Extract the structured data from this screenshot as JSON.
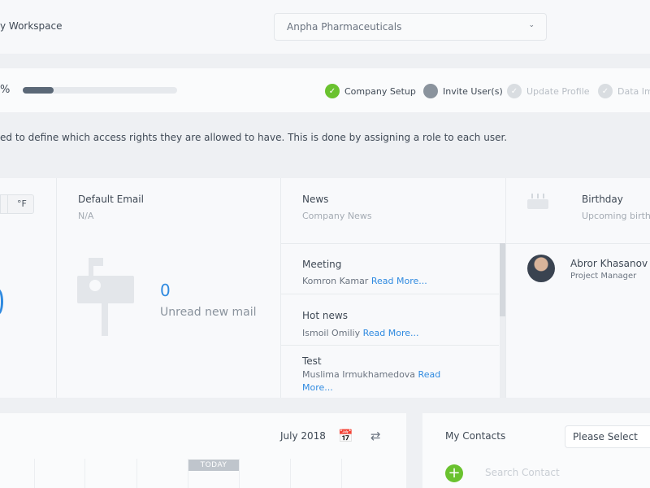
{
  "header": {
    "workspace_label": "y Workspace",
    "company_select": "Anpha Pharmaceuticals"
  },
  "onboarding": {
    "percent_text": "%",
    "progress_fraction": 0.2,
    "steps": [
      {
        "label": "Company Setup",
        "state": "done"
      },
      {
        "label": "Invite User(s)",
        "state": "current"
      },
      {
        "label": "Update Profile",
        "state": "todo"
      },
      {
        "label": "Data Im",
        "state": "todo"
      }
    ],
    "info_text": "ed to define which access rights they are allowed to have. This is done by assigning a role to each user."
  },
  "weather": {
    "unit_f": "°F"
  },
  "email": {
    "title": "Default Email",
    "subtitle": "N/A",
    "unread_count": "0",
    "unread_label": "Unread new mail"
  },
  "news": {
    "title": "News",
    "subtitle": "Company News",
    "items": [
      {
        "title": "Meeting",
        "author": "Komron Kamar",
        "read_more": "Read More..."
      },
      {
        "title": "Hot news",
        "author": "Ismoil Omiliy",
        "read_more": "Read More..."
      },
      {
        "title": "Test",
        "author": "Muslima Irmukhamedova",
        "read_more": "Read More..."
      }
    ]
  },
  "birthday": {
    "title": "Birthday",
    "subtitle": "Upcoming birth",
    "person": {
      "name": "Abror Khasanov",
      "role": "Project Manager"
    }
  },
  "calendar": {
    "month": "July 2018",
    "today_label": "TODAY"
  },
  "contacts": {
    "title": "My Contacts",
    "select": "Please Select",
    "search_placeholder": "Search Contact"
  },
  "colors": {
    "accent_blue": "#2f8ae0",
    "success_green": "#6ac22f"
  }
}
